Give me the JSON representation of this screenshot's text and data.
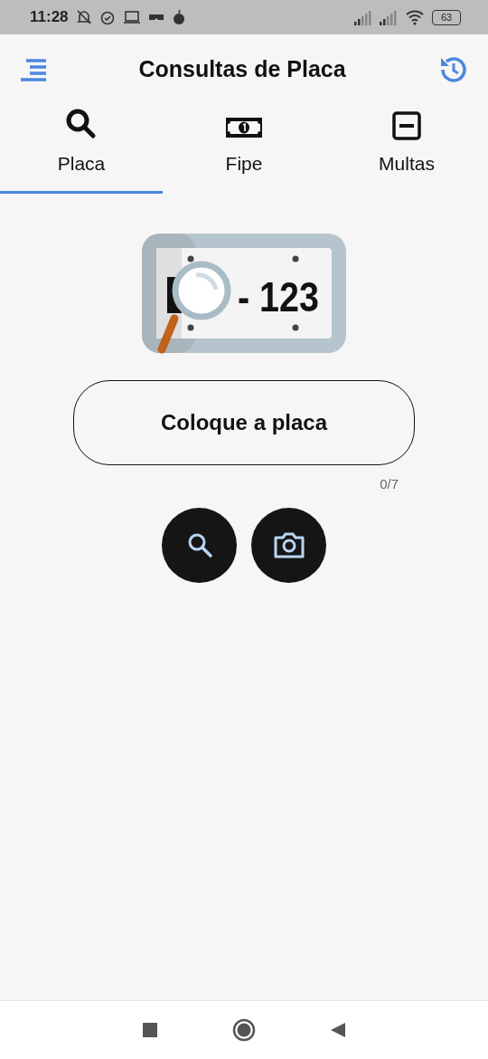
{
  "status_bar": {
    "time": "11:28",
    "battery": "63"
  },
  "header": {
    "title": "Consultas de Placa"
  },
  "tabs": [
    {
      "label": "Placa",
      "kind": "search",
      "selected": true
    },
    {
      "label": "Fipe",
      "kind": "money",
      "selected": false
    },
    {
      "label": "Multas",
      "kind": "minus",
      "selected": false
    }
  ],
  "illustration": {
    "plate_text": "- 123"
  },
  "plate_field": {
    "placeholder": "Coloque a placa",
    "counter": "0/7"
  },
  "actions": [
    {
      "kind": "search"
    },
    {
      "kind": "camera"
    }
  ]
}
